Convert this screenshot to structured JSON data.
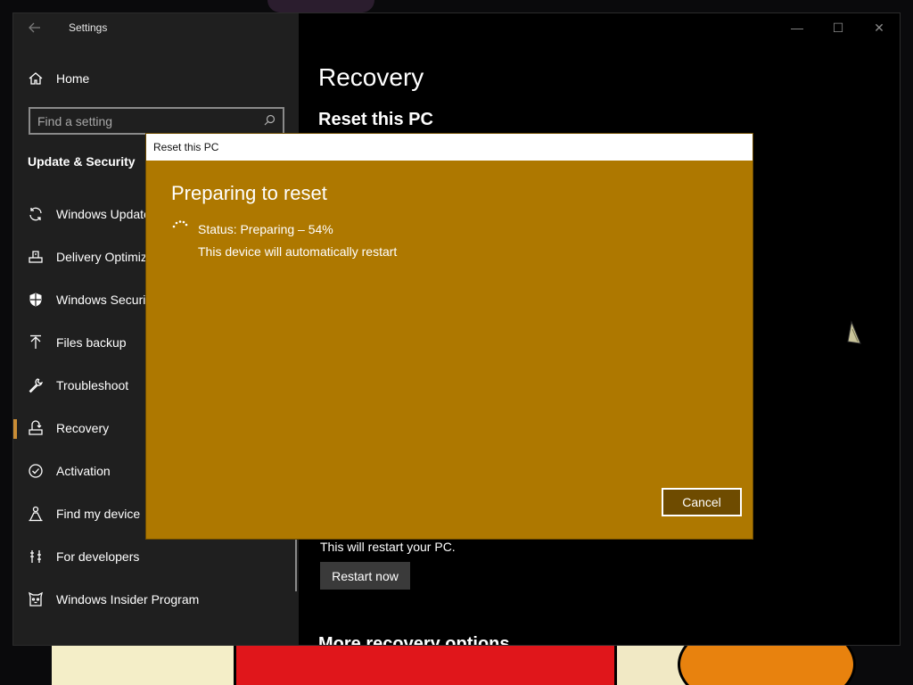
{
  "window": {
    "title": "Settings",
    "controls": {
      "minimize": "—",
      "maximize": "☐",
      "close": "✕"
    }
  },
  "sidebar": {
    "home_label": "Home",
    "search_placeholder": "Find a setting",
    "section_title": "Update & Security",
    "items": [
      {
        "label": "Windows Update",
        "icon": "sync-icon"
      },
      {
        "label": "Delivery Optimization",
        "icon": "delivery-icon"
      },
      {
        "label": "Windows Security",
        "icon": "shield-icon"
      },
      {
        "label": "Files backup",
        "icon": "upload-icon"
      },
      {
        "label": "Troubleshoot",
        "icon": "wrench-icon"
      },
      {
        "label": "Recovery",
        "icon": "recovery-icon",
        "active": true
      },
      {
        "label": "Activation",
        "icon": "check-circle-icon"
      },
      {
        "label": "Find my device",
        "icon": "person-pin-icon"
      },
      {
        "label": "For developers",
        "icon": "developer-icon"
      },
      {
        "label": "Windows Insider Program",
        "icon": "cat-icon"
      }
    ]
  },
  "main": {
    "page_title": "Recovery",
    "reset_title": "Reset this PC",
    "restart_note": "This will restart your PC.",
    "restart_button": "Restart now",
    "more_title": "More recovery options"
  },
  "dialog": {
    "title": "Reset this PC",
    "heading": "Preparing to reset",
    "status": "Status: Preparing – 54%",
    "progress_percent": 54,
    "note": "This device will automatically restart",
    "cancel_button": "Cancel",
    "background_color": "#ae7800"
  },
  "colors": {
    "accent": "#c98c35",
    "sidebar_bg": "#1f1f1f",
    "window_bg": "#000000"
  }
}
